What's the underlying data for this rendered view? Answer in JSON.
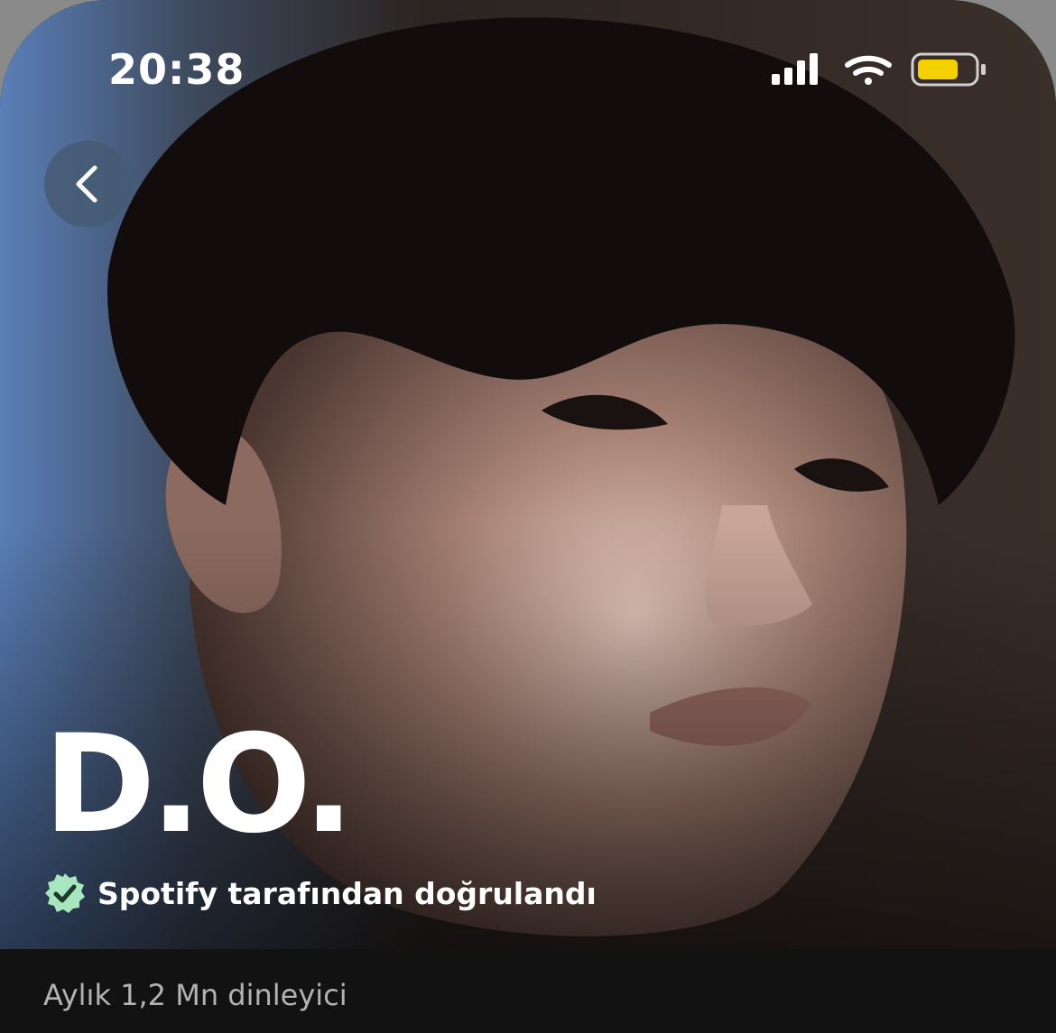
{
  "status_bar": {
    "time": "20:38",
    "icons": [
      "cellular-signal-icon",
      "wifi-icon",
      "battery-icon"
    ],
    "battery_color": "#f5d000"
  },
  "navigation": {
    "back_icon": "chevron-left-icon"
  },
  "artist": {
    "name": "D.O.",
    "verified_icon": "verified-badge-icon",
    "verified_label": "Spotify tarafından doğrulandı",
    "monthly_listeners": "Aylık 1,2 Mn dinleyici"
  },
  "colors": {
    "verified_badge": "#a8e6c0",
    "background": "#121212",
    "listeners_text": "#b3b3b3"
  }
}
